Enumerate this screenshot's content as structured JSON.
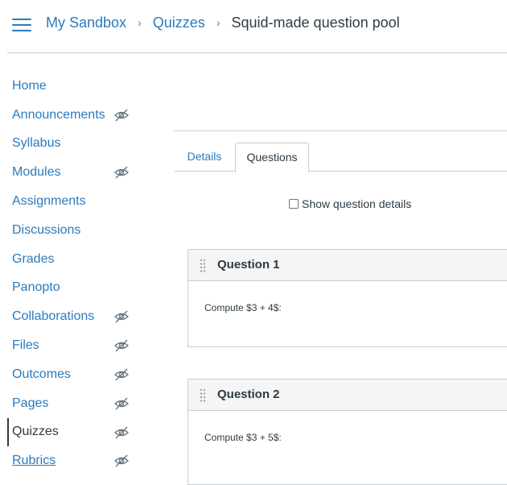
{
  "header": {
    "menu_icon": "hamburger-menu-icon",
    "breadcrumb": {
      "course": "My Sandbox",
      "section": "Quizzes",
      "current": "Squid-made question pool",
      "separator": "›"
    }
  },
  "sidebar": {
    "items": [
      {
        "label": "Home",
        "hidden_icon": false
      },
      {
        "label": "Announcements",
        "hidden_icon": true
      },
      {
        "label": "Syllabus",
        "hidden_icon": false
      },
      {
        "label": "Modules",
        "hidden_icon": true
      },
      {
        "label": "Assignments",
        "hidden_icon": false
      },
      {
        "label": "Discussions",
        "hidden_icon": false
      },
      {
        "label": "Grades",
        "hidden_icon": false
      },
      {
        "label": "Panopto",
        "hidden_icon": false
      },
      {
        "label": "Collaborations",
        "hidden_icon": true
      },
      {
        "label": "Files",
        "hidden_icon": true
      },
      {
        "label": "Outcomes",
        "hidden_icon": true
      },
      {
        "label": "Pages",
        "hidden_icon": true
      },
      {
        "label": "Quizzes",
        "hidden_icon": true,
        "active": true
      },
      {
        "label": "Rubrics",
        "hidden_icon": true
      }
    ]
  },
  "tabs": [
    {
      "label": "Details"
    },
    {
      "label": "Questions",
      "selected": true
    }
  ],
  "options": {
    "show_details_label": "Show question details",
    "show_details_checked": false
  },
  "questions": [
    {
      "title": "Question 1",
      "text": "Compute $3 + 4$:"
    },
    {
      "title": "Question 2",
      "text": "Compute $3 + 5$:"
    }
  ],
  "colors": {
    "link": "#2b7abc",
    "text": "#2d3b45",
    "border": "#c7cdd1",
    "header_bg": "#f5f5f5"
  }
}
